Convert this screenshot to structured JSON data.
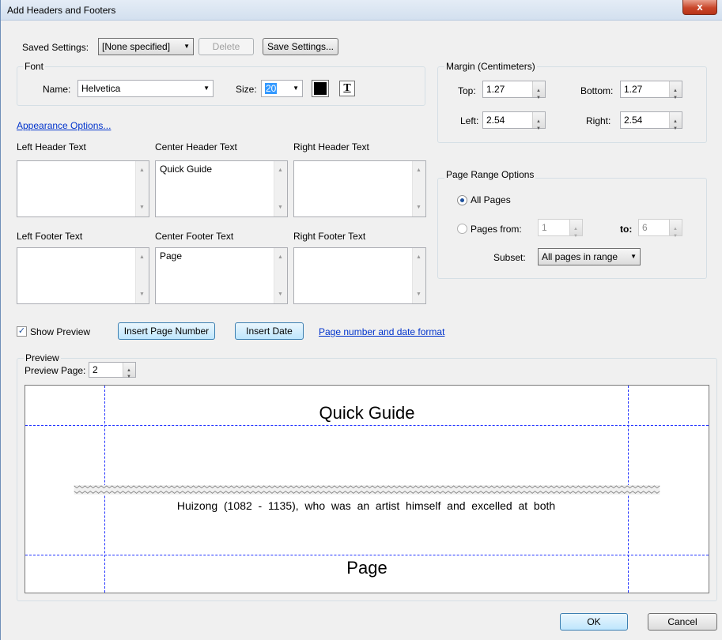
{
  "window": {
    "title": "Add Headers and Footers",
    "close_glyph": "x"
  },
  "saved_settings": {
    "label": "Saved Settings:",
    "value": "[None specified]",
    "delete_label": "Delete",
    "save_label": "Save Settings..."
  },
  "font": {
    "group_label": "Font",
    "name_label": "Name:",
    "name_value": "Helvetica",
    "size_label": "Size:",
    "size_value": "20",
    "text_icon_glyph": "T",
    "color": "#000000"
  },
  "margin": {
    "group_label": "Margin (Centimeters)",
    "top_label": "Top:",
    "top_value": "1.27",
    "bottom_label": "Bottom:",
    "bottom_value": "1.27",
    "left_label": "Left:",
    "left_value": "2.54",
    "right_label": "Right:",
    "right_value": "2.54"
  },
  "appearance_link": "Appearance Options...",
  "headers": {
    "left_label": "Left Header Text",
    "left_value": "",
    "center_label": "Center Header Text",
    "center_value": "Quick Guide",
    "right_label": "Right Header Text",
    "right_value": ""
  },
  "footers": {
    "left_label": "Left Footer Text",
    "left_value": "",
    "center_label": "Center Footer Text",
    "center_value": "Page",
    "right_label": "Right Footer Text",
    "right_value": ""
  },
  "page_range": {
    "group_label": "Page Range Options",
    "all_pages_label": "All Pages",
    "pages_from_label": "Pages from:",
    "from_value": "1",
    "to_label": "to:",
    "to_value": "6",
    "subset_label": "Subset:",
    "subset_value": "All pages in range",
    "selected": "all"
  },
  "actions": {
    "show_preview_label": "Show Preview",
    "show_preview_checked": true,
    "insert_page_number": "Insert Page Number",
    "insert_date": "Insert Date",
    "format_link": "Page number and date format"
  },
  "preview": {
    "group_label": "Preview",
    "page_label": "Preview Page:",
    "page_value": "2",
    "header_text": "Quick Guide",
    "body_text": "Huizong  (1082  -  1135),  who  was  an  artist  himself  and  excelled  at  both",
    "footer_text": "Page"
  },
  "footer_buttons": {
    "ok": "OK",
    "cancel": "Cancel"
  }
}
